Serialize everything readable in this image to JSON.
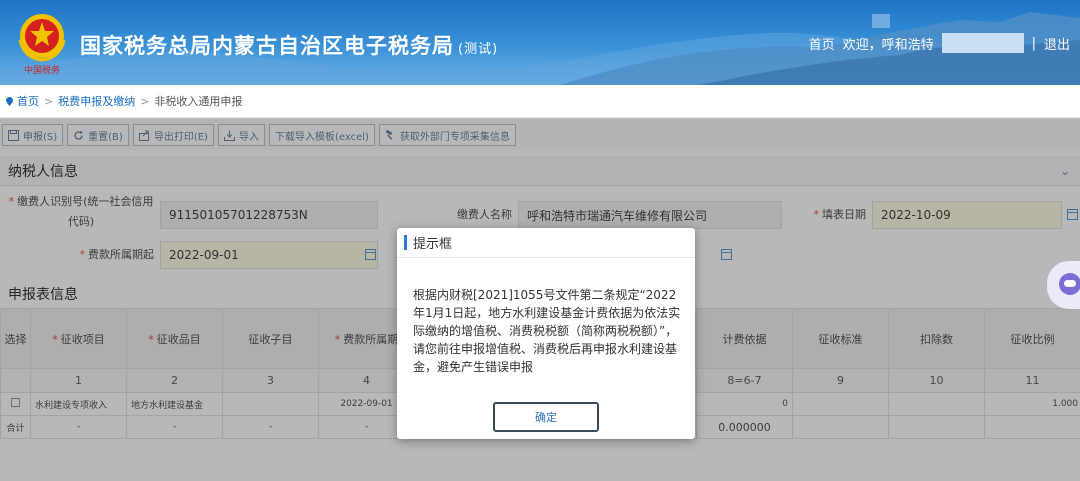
{
  "header": {
    "title": "国家税务总局内蒙古自治区电子税务局",
    "title_suffix": "(测试)",
    "emblem_caption": "中国税务",
    "nav": {
      "home": "首页",
      "welcome": "欢迎，呼和浩特",
      "divider": "|",
      "logout": "退出"
    }
  },
  "breadcrumb": {
    "home": "首页",
    "sep1": ">",
    "level1": "税费申报及缴纳",
    "sep2": ">",
    "current": "非税收入通用申报"
  },
  "toolbar": {
    "declare": "申报(S)",
    "reset": "重置(B)",
    "export_print": "导出打印(E)",
    "import": "导入",
    "download_template": "下载导入模板(excel)",
    "fetch_info": "获取外部门专项采集信息"
  },
  "taxpayer": {
    "section_title": "纳税人信息",
    "payer_id_label": "缴费人识别号(统一社会信用代码)",
    "payer_id_value": "91150105701228753N",
    "payer_name_label": "缴费人名称",
    "payer_name_value": "呼和浩特市瑞通汽车维修有限公司",
    "fill_date_label": "填表日期",
    "fill_date_value": "2022-10-09",
    "period_start_label": "费款所属期起",
    "period_start_value": "2022-09-01"
  },
  "report": {
    "section_title": "申报表信息",
    "columns": [
      "选择",
      "征收项目",
      "征收品目",
      "征收子目",
      "费款所属期",
      "",
      "",
      "",
      "计费依据",
      "征收标准",
      "扣除数",
      "征收比例"
    ],
    "column_numbers": [
      "",
      "1",
      "2",
      "3",
      "4",
      "",
      "",
      "",
      "8=6-7",
      "9",
      "10",
      "11"
    ],
    "row1": [
      "",
      "水利建设专项收入",
      "地方水利建设基金",
      "",
      "2022-09-01",
      "",
      "",
      "0",
      "0",
      "",
      "",
      "1.000"
    ],
    "total": [
      "合计",
      "-",
      "-",
      "-",
      "-",
      "",
      "",
      "000",
      "0.000000",
      "",
      "",
      ""
    ]
  },
  "dialog": {
    "title": "提示框",
    "message": "根据内财税[2021]1055号文件第二条规定“2022年1月1日起，地方水利建设基金计费依据为依法实际缴纳的增值税、消费税税额（简称两税税额）”，请您前往申报增值税、消费税后再申报水利建设基金，避免产生错误申报",
    "ok": "确定"
  },
  "colors": {
    "header_blue": "#1e74c4",
    "accent_blue": "#2d7bd1",
    "required_red": "#e05a5a"
  }
}
